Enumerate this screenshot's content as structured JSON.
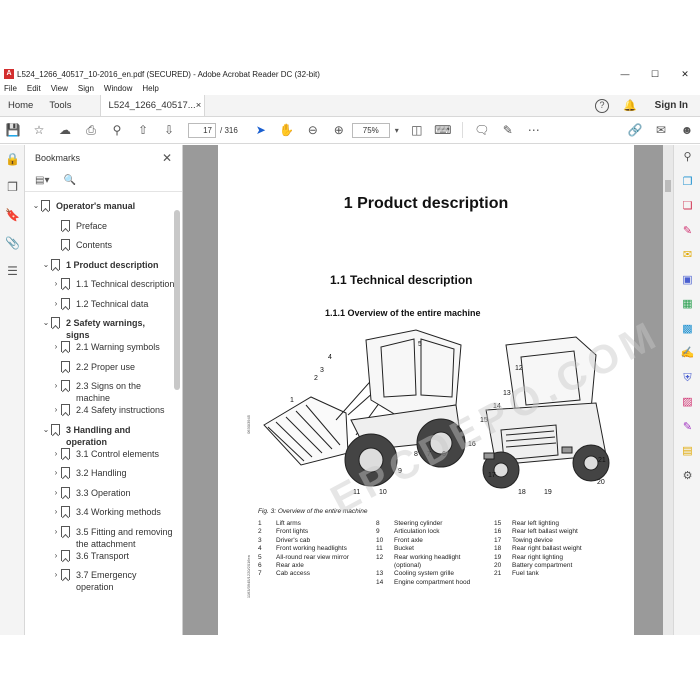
{
  "window": {
    "title": "L524_1266_40517_10-2016_en.pdf (SECURED) - Adobe Acrobat Reader DC (32-bit)",
    "minimize": "—",
    "maximize": "☐",
    "close": "✕"
  },
  "menu": [
    "File",
    "Edit",
    "View",
    "Sign",
    "Window",
    "Help"
  ],
  "tabs": {
    "home": "Home",
    "tools": "Tools",
    "doc": "L524_1266_40517...",
    "doc_close": "×",
    "help": "?",
    "signin": "Sign In"
  },
  "toolbar": {
    "page_current": "17",
    "page_total": "/ 316",
    "zoom": "75%"
  },
  "bookmarks": {
    "title": "Bookmarks",
    "close": "✕",
    "items": [
      {
        "label": "Operator's manual",
        "level": 0,
        "toggle": "⌄"
      },
      {
        "label": "Preface",
        "level": 2,
        "toggle": ""
      },
      {
        "label": "Contents",
        "level": 2,
        "toggle": ""
      },
      {
        "label": "1 Product description",
        "level": 1,
        "toggle": "⌄"
      },
      {
        "label": "1.1 Technical description",
        "level": 2,
        "toggle": "›"
      },
      {
        "label": "1.2 Technical data",
        "level": 2,
        "toggle": "›"
      },
      {
        "label": "2 Safety warnings, signs",
        "level": 1,
        "toggle": "⌄"
      },
      {
        "label": "2.1 Warning symbols",
        "level": 2,
        "toggle": "›"
      },
      {
        "label": "2.2 Proper use",
        "level": 2,
        "toggle": ""
      },
      {
        "label": "2.3 Signs on the machine",
        "level": 2,
        "toggle": "›"
      },
      {
        "label": "2.4 Safety instructions",
        "level": 2,
        "toggle": "›"
      },
      {
        "label": "3 Handling and operation",
        "level": 1,
        "toggle": "⌄"
      },
      {
        "label": "3.1 Control elements",
        "level": 2,
        "toggle": "›"
      },
      {
        "label": "3.2 Handling",
        "level": 2,
        "toggle": "›"
      },
      {
        "label": "3.3 Operation",
        "level": 2,
        "toggle": "›"
      },
      {
        "label": "3.4 Working methods",
        "level": 2,
        "toggle": "›"
      },
      {
        "label": "3.5 Fitting and removing the attachment",
        "level": 2,
        "toggle": "›"
      },
      {
        "label": "3.6 Transport",
        "level": 2,
        "toggle": "›"
      },
      {
        "label": "3.7 Emergency operation",
        "level": 2,
        "toggle": "›"
      }
    ]
  },
  "page": {
    "heading1": "1  Product description",
    "heading2": "1.1  Technical description",
    "heading3": "1.1.1   Overview of the entire machine",
    "fig_caption": "Fig. 3: Overview of the entire machine",
    "side_code": "0630/3945",
    "side_code2": "1163/3945/1220/2016en",
    "watermark": "EPCDEPO.COM",
    "callouts_left": [
      "1",
      "2",
      "3",
      "4",
      "5",
      "6",
      "7",
      "8",
      "9",
      "10",
      "11"
    ],
    "callouts_right": [
      "12",
      "13",
      "14",
      "15",
      "16",
      "17",
      "18",
      "19",
      "20",
      "21"
    ],
    "legend": [
      [
        {
          "n": "1",
          "t": "Lift arms"
        },
        {
          "n": "2",
          "t": "Front lights"
        },
        {
          "n": "3",
          "t": "Driver's cab"
        },
        {
          "n": "4",
          "t": "Front working headlights"
        },
        {
          "n": "5",
          "t": "All-round rear view mirror"
        },
        {
          "n": "",
          "t": ""
        },
        {
          "n": "6",
          "t": "Rear axle"
        },
        {
          "n": "7",
          "t": "Cab access"
        }
      ],
      [
        {
          "n": "8",
          "t": "Steering cylinder"
        },
        {
          "n": "9",
          "t": "Articulation lock"
        },
        {
          "n": "10",
          "t": "Front axle"
        },
        {
          "n": "11",
          "t": "Bucket"
        },
        {
          "n": "12",
          "t": "Rear working headlight"
        },
        {
          "n": "",
          "t": "(optional)"
        },
        {
          "n": "13",
          "t": "Cooling system grille"
        },
        {
          "n": "14",
          "t": "Engine compartment hood"
        }
      ],
      [
        {
          "n": "15",
          "t": "Rear left lighting"
        },
        {
          "n": "16",
          "t": "Rear left ballast weight"
        },
        {
          "n": "17",
          "t": "Towing device"
        },
        {
          "n": "18",
          "t": "Rear right ballast weight"
        },
        {
          "n": "19",
          "t": "Rear right lighting"
        },
        {
          "n": "",
          "t": ""
        },
        {
          "n": "20",
          "t": "Battery compartment"
        },
        {
          "n": "21",
          "t": "Fuel tank"
        }
      ]
    ]
  }
}
